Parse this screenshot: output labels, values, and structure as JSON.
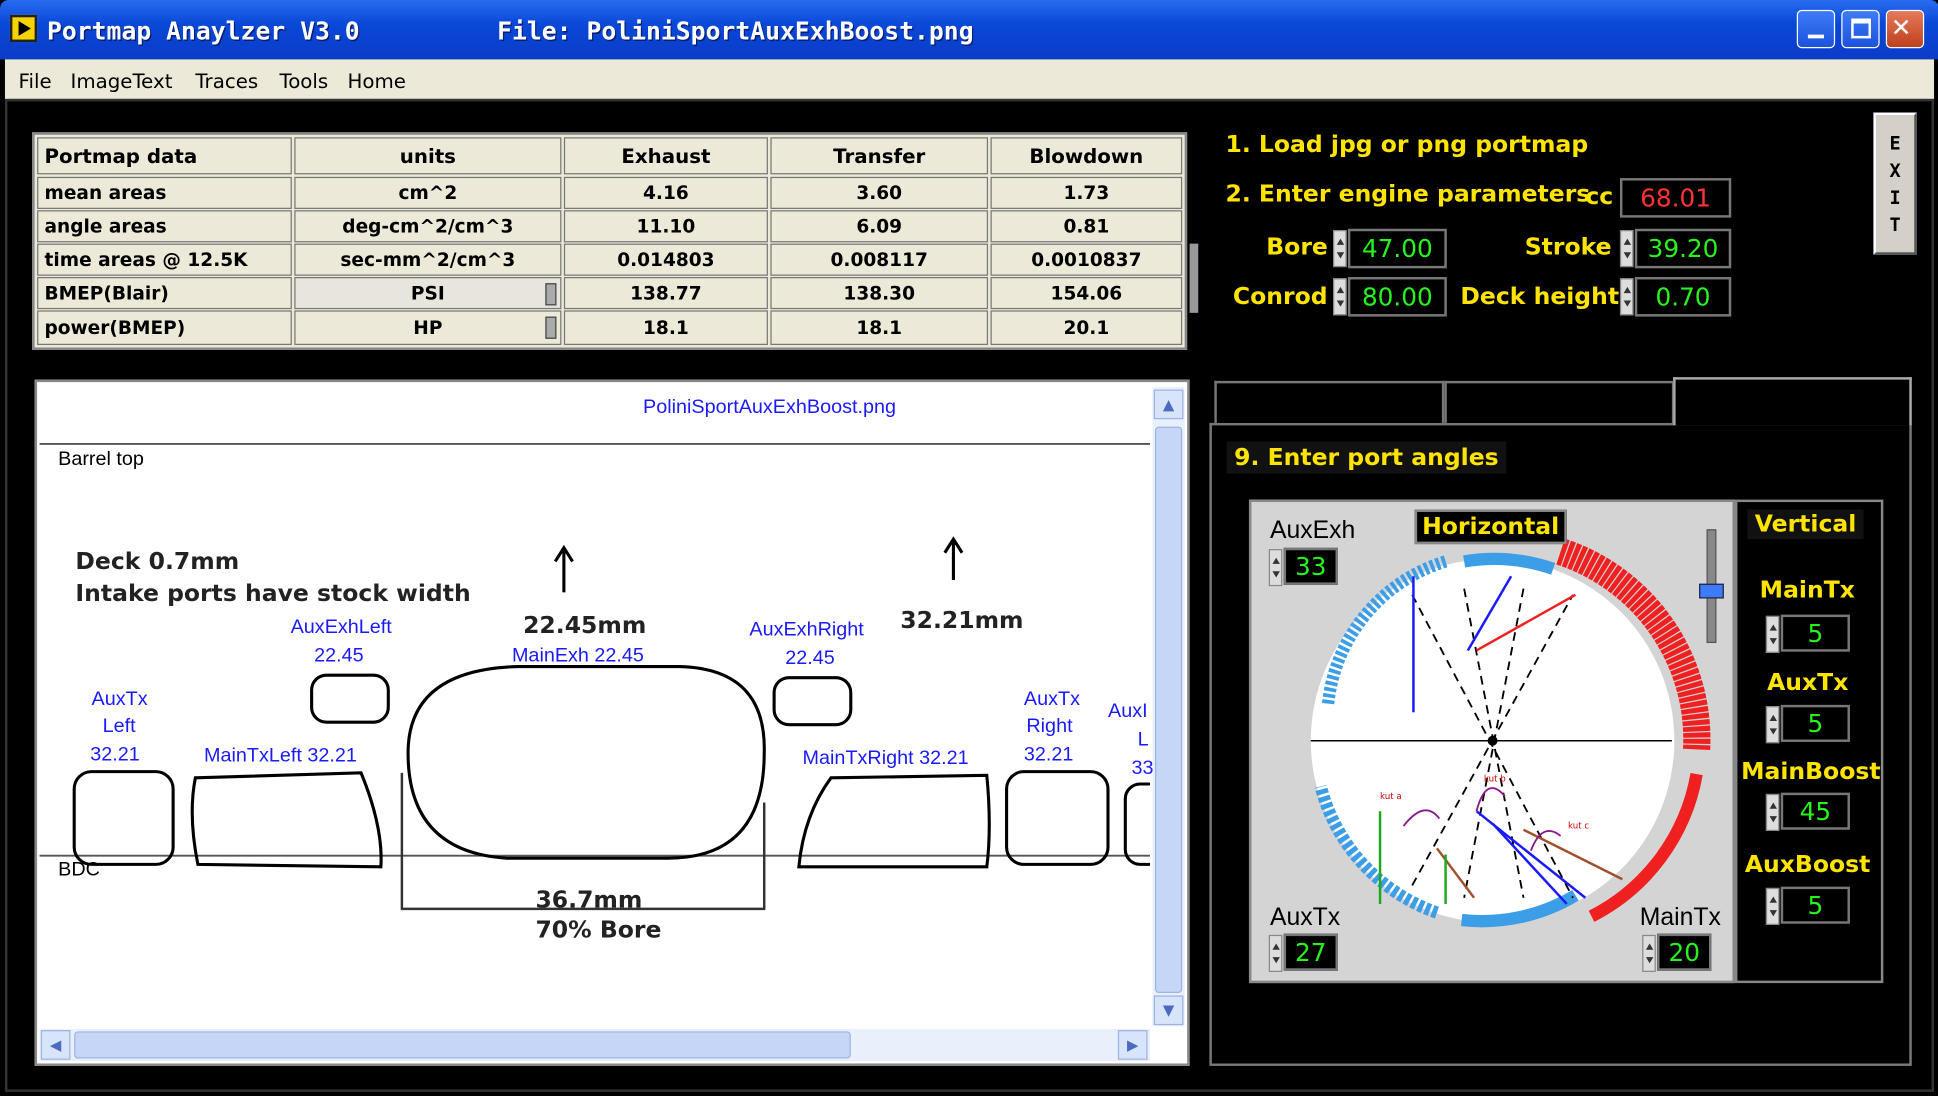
{
  "window": {
    "title": "Portmap Anaylzer V3.0",
    "file": "File: PoliniSportAuxExhBoost.png"
  },
  "menu": [
    "File",
    "ImageText",
    "Traces",
    "Tools",
    "Home"
  ],
  "table": {
    "headers": [
      "Portmap data",
      "units",
      "Exhaust",
      "Transfer",
      "Blowdown"
    ],
    "rows": [
      [
        "mean areas",
        "cm^2",
        "4.16",
        "3.60",
        "1.73"
      ],
      [
        "angle areas",
        "deg-cm^2/cm^3",
        "11.10",
        "6.09",
        "0.81"
      ],
      [
        "time areas @ 12.5K",
        "sec-mm^2/cm^3",
        "0.014803",
        "0.008117",
        "0.0010837"
      ],
      [
        "BMEP(Blair)",
        "PSI",
        "138.77",
        "138.30",
        "154.06"
      ],
      [
        "power(BMEP)",
        "HP",
        "18.1",
        "18.1",
        "20.1"
      ]
    ]
  },
  "steps": {
    "s1": "1. Load jpg or png portmap",
    "s2": "2. Enter engine parameters",
    "cc_label": "cc",
    "cc": "68.01",
    "bore_label": "Bore",
    "bore": "47.00",
    "stroke_label": "Stroke",
    "stroke": "39.20",
    "conrod_label": "Conrod",
    "conrod": "80.00",
    "deck_label": "Deck height",
    "deck": "0.70"
  },
  "exit_label": "EXIT",
  "image": {
    "filename": "PoliniSportAuxExhBoost.png",
    "barrel_top": "Barrel top",
    "bdc": "BDC",
    "note1": "Deck 0.7mm",
    "note2": "Intake ports have stock width",
    "dim1": "22.45mm",
    "dim2": "32.21mm",
    "dim3": "36.7mm",
    "dim4": "70% Bore",
    "auxexhleft": "AuxExhLeft",
    "auxexhleft_v": "22.45",
    "mainexh": "MainExh 22.45",
    "auxexhright": "AuxExhRight",
    "auxexhright_v": "22.45",
    "auxtxleft_1": "AuxTx",
    "auxtxleft_2": "Left",
    "auxtxleft_3": "32.21",
    "maintxleft": "MainTxLeft 32.21",
    "maintxright": "MainTxRight 32.21",
    "auxtxright_1": "AuxTx",
    "auxtxright_2": "Right",
    "auxtxright_3": "32.21",
    "auxcut_1": "AuxI",
    "auxcut_2": "L",
    "auxcut_3": "33"
  },
  "angles": {
    "step9": "9. Enter port angles",
    "horizontal": "Horizontal",
    "vertical": "Vertical",
    "auxexh_label": "AuxExh",
    "auxexh": "33",
    "auxtx_label": "AuxTx",
    "auxtx": "27",
    "maintx_label": "MainTx",
    "maintx": "20",
    "v_maintx_label": "MainTx",
    "v_maintx": "5",
    "v_auxtx_label": "AuxTx",
    "v_auxtx": "5",
    "v_mainboost_label": "MainBoost",
    "v_mainboost": "45",
    "v_auxboost_label": "AuxBoost",
    "v_auxboost": "5",
    "tiny1": "kut a",
    "tiny2": "kut b",
    "tiny3": "kut c"
  },
  "colors": {
    "title": "#0a48d8",
    "accent_yellow": "#ffe400",
    "value_green": "#27f41d",
    "cc_red": "#ff3333",
    "port_blue": "#3d9ee8",
    "port_red": "#f02020",
    "link_blue": "#1a1aff"
  }
}
